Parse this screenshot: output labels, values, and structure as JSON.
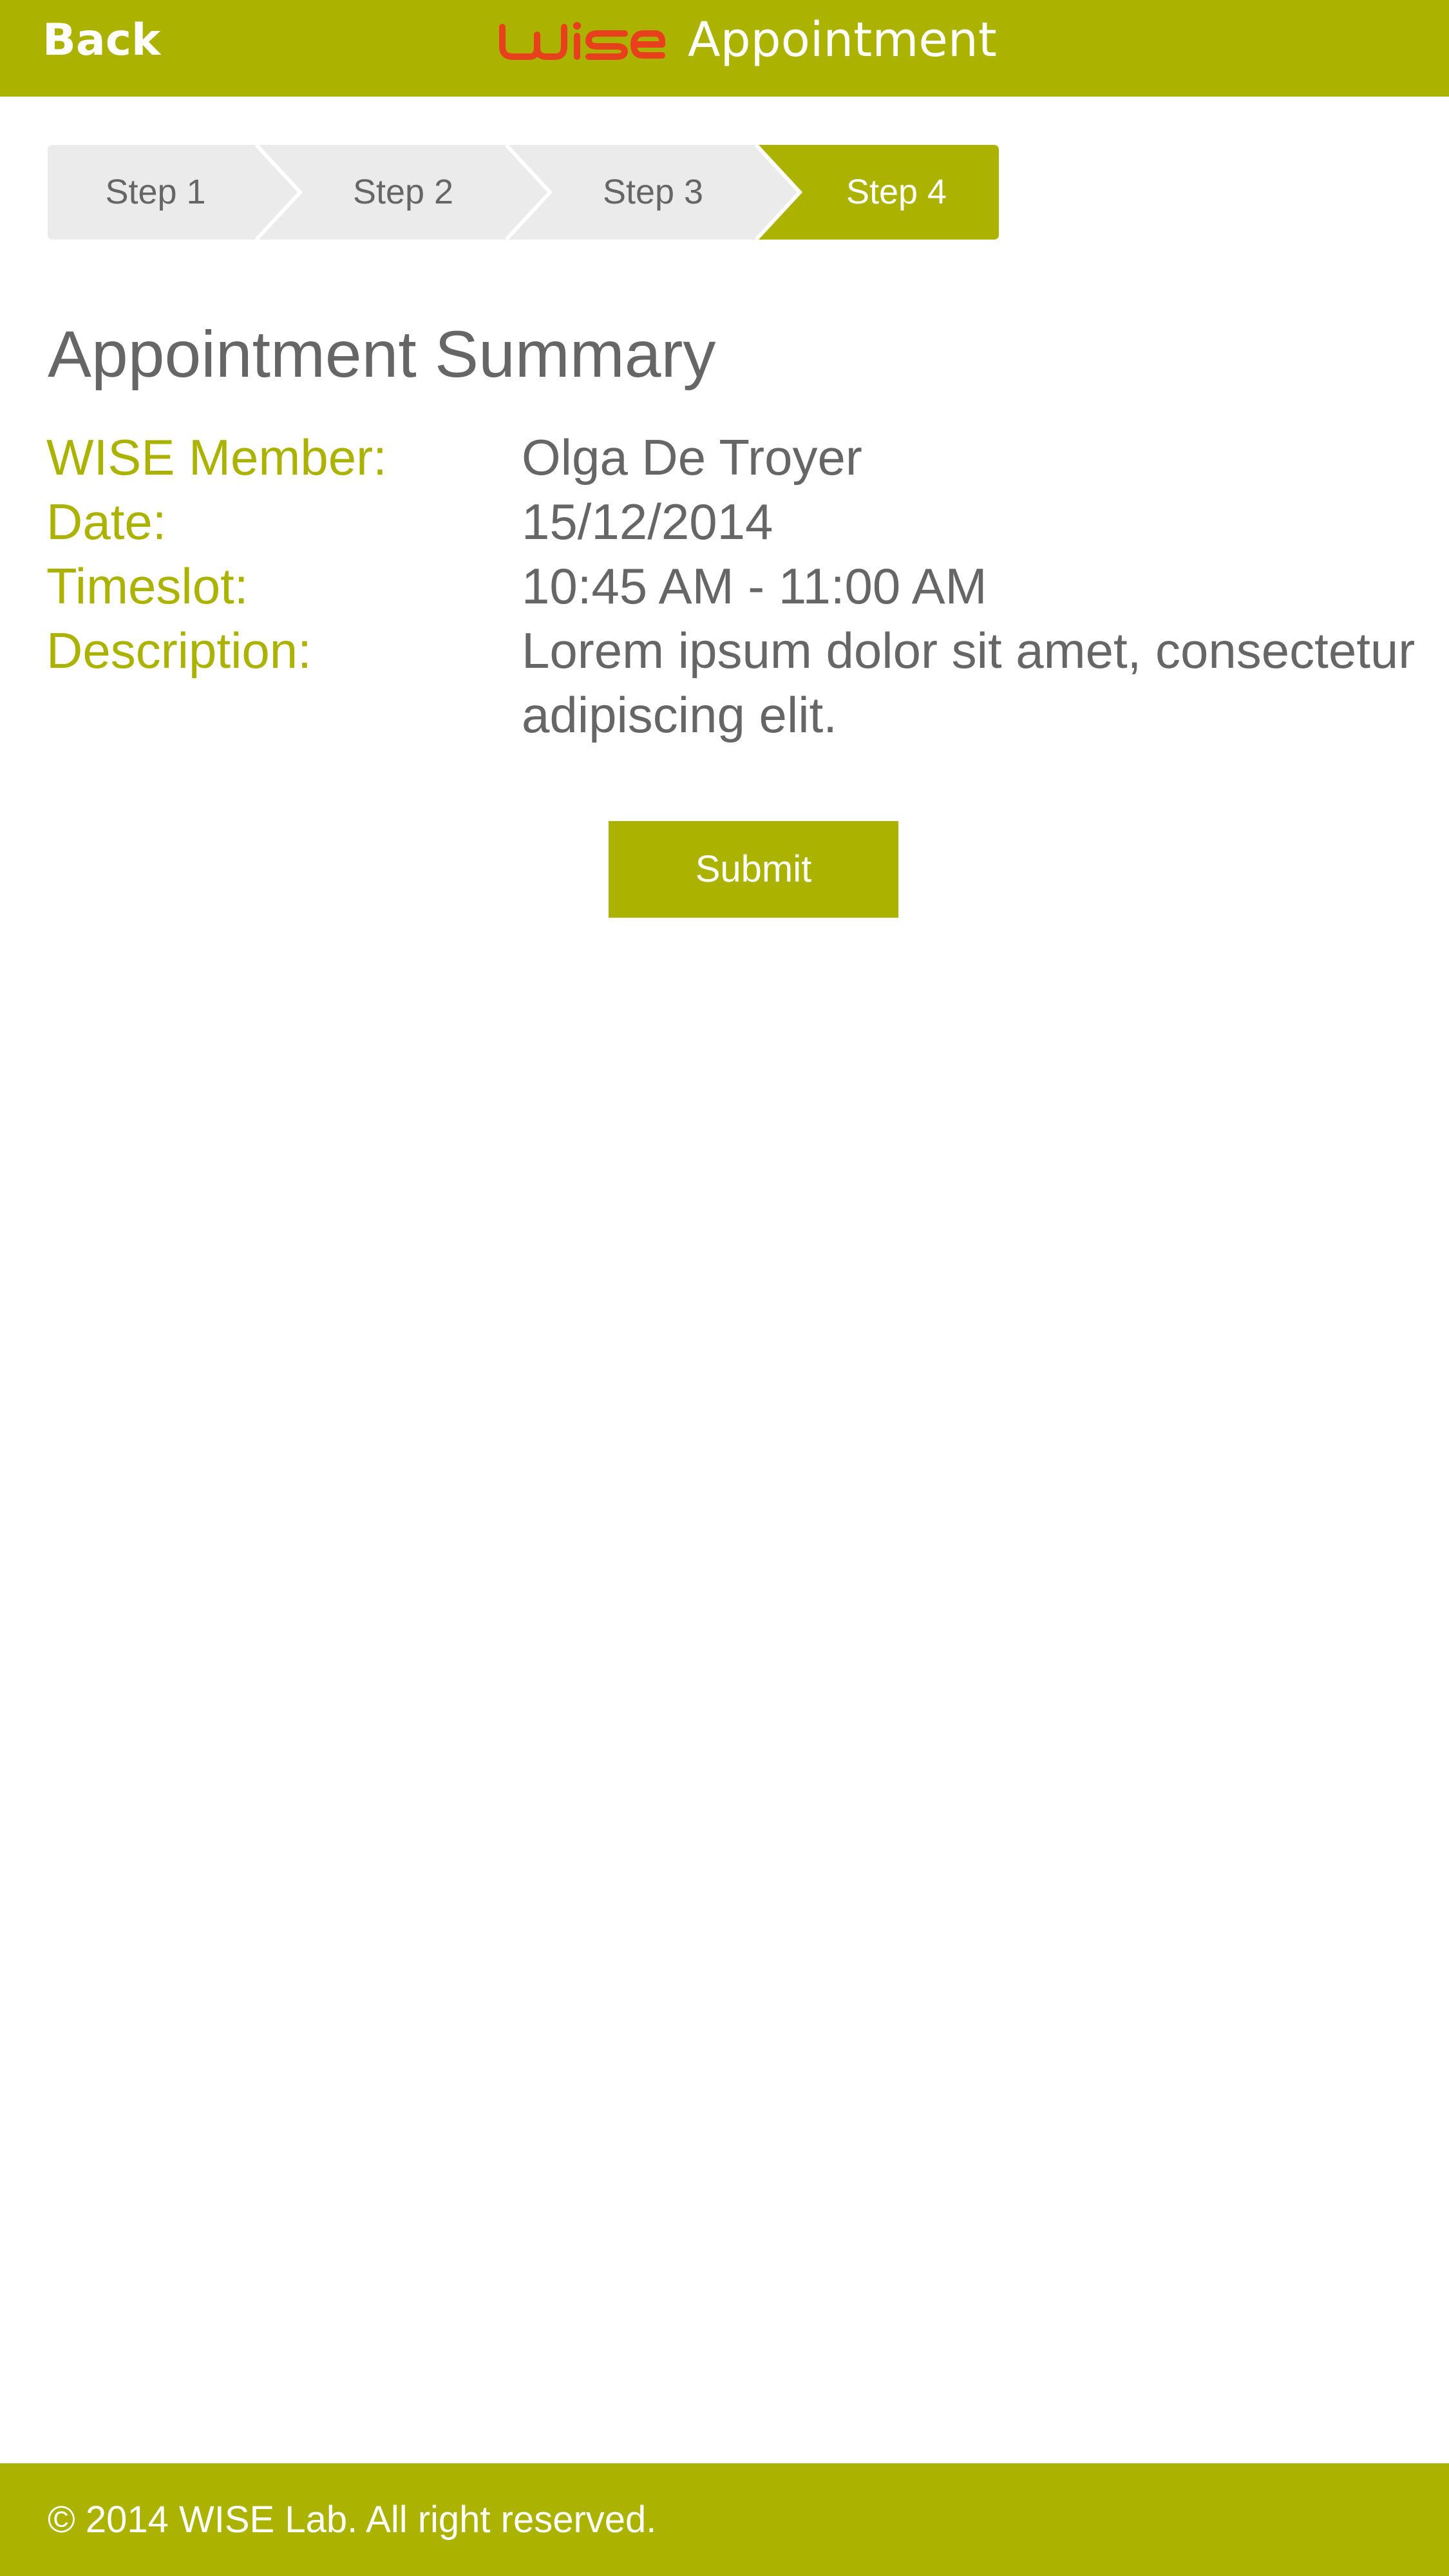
{
  "header": {
    "back_label": "Back",
    "logo_text": "WISE",
    "title": "Appointment"
  },
  "stepper": {
    "steps": [
      {
        "label": "Step 1",
        "active": false
      },
      {
        "label": "Step 2",
        "active": false
      },
      {
        "label": "Step 3",
        "active": false
      },
      {
        "label": "Step 4",
        "active": true
      }
    ]
  },
  "summary": {
    "title": "Appointment Summary",
    "rows": [
      {
        "label": "WISE Member:",
        "value": "Olga De Troyer"
      },
      {
        "label": "Date:",
        "value": "15/12/2014"
      },
      {
        "label": "Timeslot:",
        "value": "10:45 AM - 11:00 AM"
      },
      {
        "label": "Description:",
        "value": "Lorem ipsum dolor sit  amet, consectetur adipiscing elit."
      }
    ]
  },
  "submit_label": "Submit",
  "footer": {
    "copyright": "© 2014 WISE Lab. All right reserved."
  },
  "colors": {
    "accent": "#abb300",
    "logo": "#e8401c",
    "step_inactive": "#ebebeb",
    "text": "#666666"
  }
}
